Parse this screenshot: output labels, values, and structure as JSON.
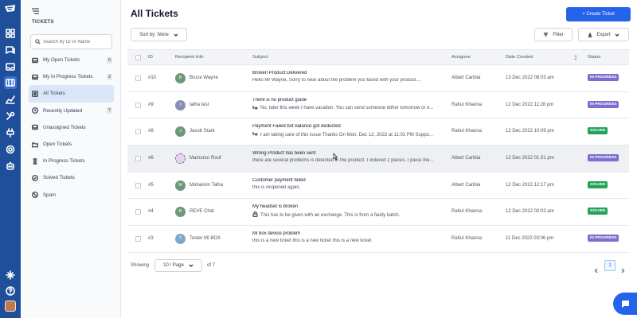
{
  "sidebar": {
    "section_label": "TICKETS",
    "search_placeholder": "Search by ID or Name",
    "items": [
      {
        "label": "My Open Tickets",
        "count": "0",
        "icon": "inbox-icon"
      },
      {
        "label": "My In Progress Tickets",
        "count": "2",
        "icon": "inbox-icon"
      },
      {
        "label": "All Tickets",
        "count": "",
        "icon": "list-icon",
        "active": true
      },
      {
        "label": "Recently Updated",
        "count": "7",
        "icon": "clock-icon"
      },
      {
        "label": "Unassigned Tickets",
        "count": "",
        "icon": "inbox-icon"
      },
      {
        "label": "Open Tickets",
        "count": "",
        "icon": "folder-icon"
      },
      {
        "label": "In Progress Tickets",
        "count": "",
        "icon": "hourglass-icon"
      },
      {
        "label": "Solved Tickets",
        "count": "",
        "icon": "check-circle-icon"
      },
      {
        "label": "Spam",
        "count": "",
        "icon": "ban-icon"
      }
    ]
  },
  "header": {
    "title": "All Tickets",
    "create_label": "+ Create Ticket",
    "sort_label": "Sort by: None",
    "filter_label": "Filter",
    "export_label": "Export"
  },
  "table": {
    "columns": {
      "id": "ID",
      "recipient": "Recipient Info",
      "subject": "Subject",
      "assignee": "Assignee",
      "date": "Date Created",
      "status": "Status"
    },
    "rows": [
      {
        "id": "#10",
        "initial": "B",
        "avatar_color": "#6b9a78",
        "name": "Bruce Wayne",
        "subject": "Broken Product Delivered",
        "preview": "Hello Mr Wayne, Sorry to hear about the problem you faced with your product....",
        "preview_icon": "",
        "assignee": "Albert Caribia",
        "date": "13 Dec 2022 08:03 am",
        "status": "IN PROGRESS"
      },
      {
        "id": "#9",
        "initial": "t",
        "avatar_color": "#8a8fb5",
        "name": "talha test",
        "subject": "There is no product guide",
        "preview": "No, later this week I have vacation. You can send someone either tomorrow or e...",
        "preview_icon": "reply-icon",
        "assignee": "Rahul Khanna",
        "date": "12 Dec 2022 11:28 pm",
        "status": "IN PROGRESS"
      },
      {
        "id": "#8",
        "initial": "J",
        "avatar_color": "#6b9a78",
        "name": "Jacob Stark",
        "subject": "Payment Failed but balance got deducted",
        "preview": "I am taking care of this issue Thanks On Mon, Dec 12, 2022 at 11:02 PM Suppo...",
        "preview_icon": "reply-icon",
        "assignee": "Rahul Khanna",
        "date": "12 Dec 2022 10:09 pm",
        "status": "SOLVED"
      },
      {
        "id": "#6",
        "initial": "",
        "avatar_color": "#e5d4f0",
        "name": "Mamunur Rouf",
        "subject": "Wrong Product has been sent",
        "preview": "there are several problems is detected in the product. I ordered 2 pieces. I piece the...",
        "preview_icon": "",
        "assignee": "Albert Caribia",
        "date": "12 Dec 2022 01:31 pm",
        "status": "IN PROGRESS"
      },
      {
        "id": "#5",
        "initial": "M",
        "avatar_color": "#6b9a78",
        "name": "Mohaimin Talha",
        "subject": "Customer payment failed",
        "preview": "this is reopened again.",
        "preview_icon": "",
        "assignee": "Albert Caribia",
        "date": "12 Dec 2022 12:17 pm",
        "status": "SOLVED"
      },
      {
        "id": "#4",
        "initial": "R",
        "avatar_color": "#6b9a78",
        "name": "REVE Chat",
        "subject": "My headset is broken",
        "preview": "This has to be given with an exchange. This is from a faulty batch.",
        "preview_icon": "lock-icon",
        "assignee": "Rahul Khanna",
        "date": "12 Dec 2022 02:03 am",
        "status": "SOLVED"
      },
      {
        "id": "#3",
        "initial": "T",
        "avatar_color": "#7fa7c8",
        "name": "Tester MI BOX",
        "subject": "Mi box device problem",
        "preview": "this is a new ticket this is a new ticket this is a new ticket",
        "preview_icon": "",
        "assignee": "Rahul Khanna",
        "date": "11 Dec 2022 03:06 pm",
        "status": "IN PROGRESS"
      }
    ]
  },
  "status_colors": {
    "IN PROGRESS": "#7c6fcf",
    "SOLVED": "#22a35a"
  },
  "pagination": {
    "showing_label": "Showing",
    "per_page": "10 / Page",
    "of_total": "of 7",
    "current_page": "1"
  }
}
